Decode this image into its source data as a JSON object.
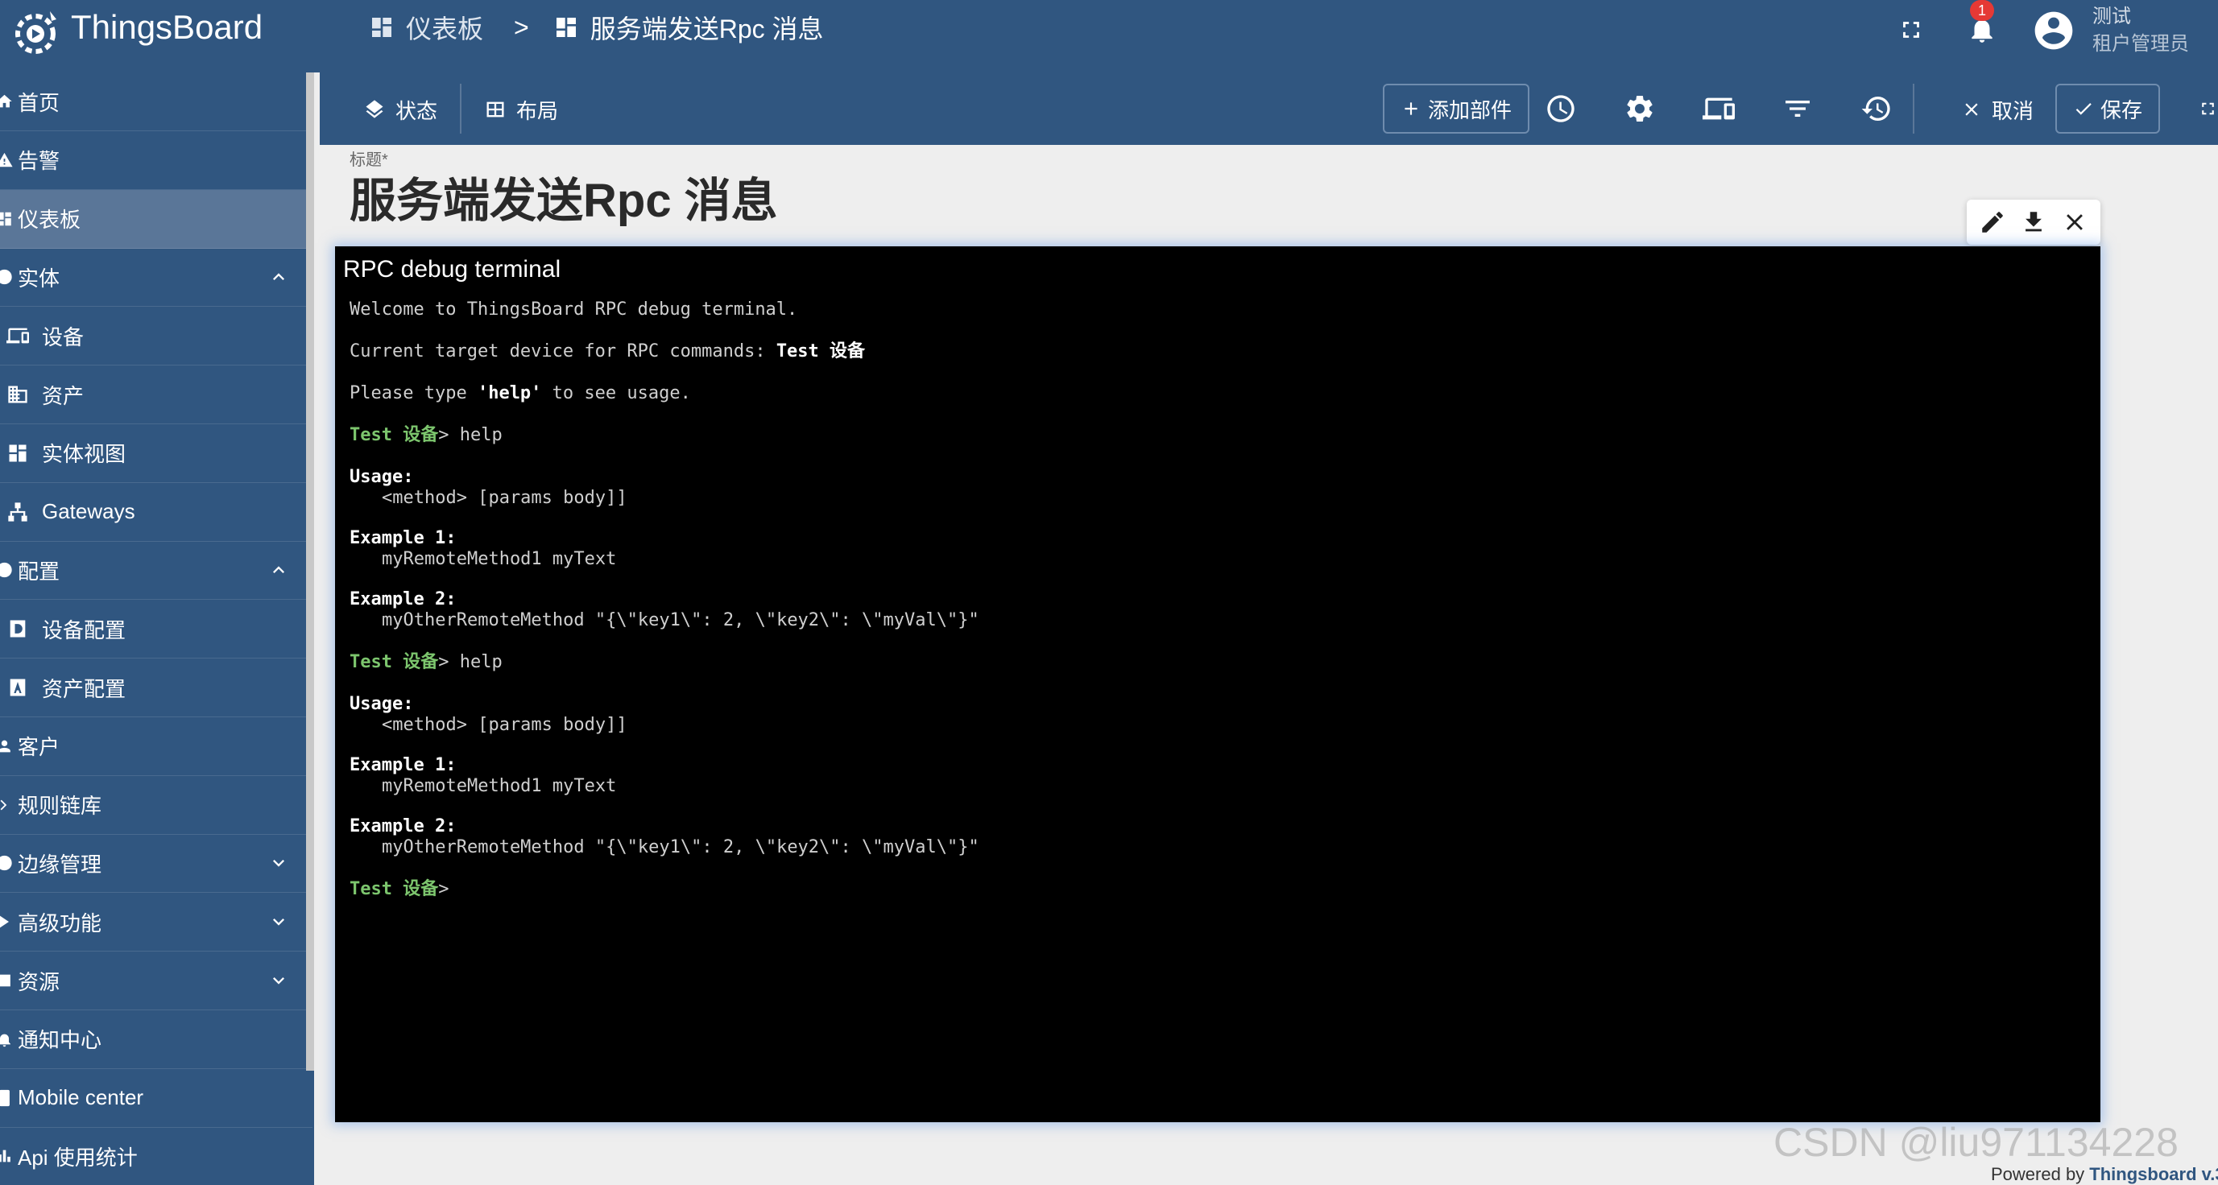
{
  "app": {
    "name": "ThingsBoard"
  },
  "breadcrumb": {
    "root": "仪表板",
    "separator": ">",
    "current": "服务端发送Rpc 消息"
  },
  "header": {
    "notification_count": "1",
    "user_name": "测试",
    "user_role": "租户管理员"
  },
  "sidebar": {
    "items": [
      {
        "label": "首页",
        "icon": "home-icon"
      },
      {
        "label": "告警",
        "icon": "alarm-icon"
      },
      {
        "label": "仪表板",
        "icon": "dashboard-icon",
        "active": true
      },
      {
        "label": "实体",
        "icon": "entity-icon",
        "expand": "up"
      },
      {
        "label": "设备",
        "icon": "devices-icon",
        "sub": true
      },
      {
        "label": "资产",
        "icon": "asset-icon",
        "sub": true
      },
      {
        "label": "实体视图",
        "icon": "entity-view-icon",
        "sub": true
      },
      {
        "label": "Gateways",
        "icon": "gateway-icon",
        "sub": true
      },
      {
        "label": "配置",
        "icon": "profile-icon",
        "expand": "up"
      },
      {
        "label": "设备配置",
        "icon": "device-profile-icon",
        "sub": true
      },
      {
        "label": "资产配置",
        "icon": "asset-profile-icon",
        "sub": true
      },
      {
        "label": "客户",
        "icon": "customer-icon"
      },
      {
        "label": "规则链库",
        "icon": "rule-chain-icon"
      },
      {
        "label": "边缘管理",
        "icon": "edge-icon",
        "expand": "down"
      },
      {
        "label": "高级功能",
        "icon": "advanced-icon",
        "expand": "down"
      },
      {
        "label": "资源",
        "icon": "resource-icon",
        "expand": "down"
      },
      {
        "label": "通知中心",
        "icon": "notification-center-icon"
      },
      {
        "label": "Mobile center",
        "icon": "mobile-icon"
      },
      {
        "label": "Api 使用统计",
        "icon": "api-usage-icon"
      }
    ]
  },
  "toolbar": {
    "state_label": "状态",
    "layout_label": "布局",
    "add_widget_label": "添加部件",
    "cancel_label": "取消",
    "save_label": "保存"
  },
  "dashboard": {
    "title_label": "标题*",
    "title": "服务端发送Rpc 消息"
  },
  "terminal": {
    "title": "RPC debug terminal",
    "welcome": "Welcome to ThingsBoard RPC debug terminal.",
    "target_prefix": "Current target device for RPC commands: ",
    "target_device": "Test 设备",
    "help_prefix": "Please type ",
    "help_keyword": "'help'",
    "help_suffix": " to see usage.",
    "prompt": "Test 设备",
    "prompt_arrow": ">",
    "command": " help",
    "usage_label": "Usage:",
    "usage_text": "<method> [params body]]",
    "example1_label": "Example 1:",
    "example1_text": "myRemoteMethod1 myText",
    "example2_label": "Example 2:",
    "example2_text": "myOtherRemoteMethod \"{\\\"key1\\\": 2, \\\"key2\\\": \\\"myVal\\\"}\""
  },
  "watermark": "CSDN @liu971134228",
  "footer": {
    "powered_prefix": "Powered by ",
    "powered_link": "Thingsboard v.3."
  }
}
